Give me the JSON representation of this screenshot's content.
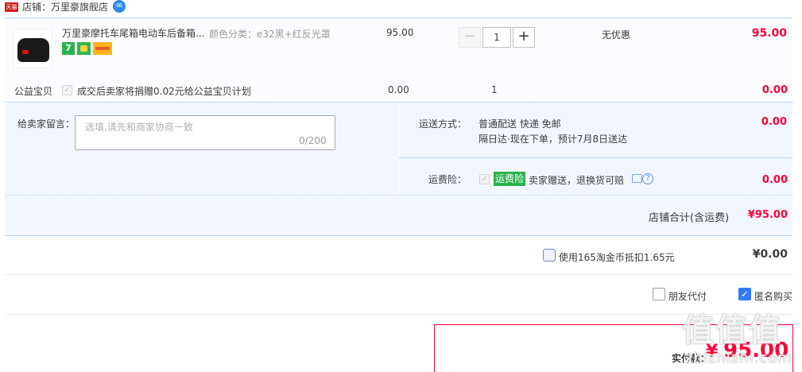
{
  "shop": {
    "name": "店铺：万里豪旗舰店",
    "logo_text": "天猫"
  },
  "item": {
    "title": "万里豪摩托车尾箱电动车后备箱...",
    "sku": "颜色分类：e32黑+红反光罩",
    "badges": [
      "7"
    ],
    "unit_price": "95.00",
    "quantity": "1",
    "minus_symbol": "−",
    "plus_symbol": "+",
    "discount": "无优惠",
    "total": "95.00"
  },
  "charity": {
    "label": "公益宝贝",
    "text": "成交后卖家将捐赠0.02元给公益宝贝计划",
    "price": "0.00",
    "qty": "1",
    "total": "0.00"
  },
  "message": {
    "label": "给卖家留言：",
    "placeholder": "选填,请先和商家协商一致",
    "counter": "0/200"
  },
  "shipping": {
    "label": "运送方式：",
    "method": "普通配送 快递 免邮",
    "eta": "隔日达·现在下单，预计7月8日送达",
    "fee": "0.00"
  },
  "insurance": {
    "label": "运费险：",
    "tag": "运费险",
    "text": "卖家赠送，退换货可赔",
    "help": "?",
    "fee": "0.00"
  },
  "shop_total": {
    "label": "店铺合计(含运费)",
    "value": "¥95.00"
  },
  "coins": {
    "text": "使用165淘金币抵扣1.65元",
    "value": "¥0.00"
  },
  "options": {
    "friend_pay": "朋友代付",
    "anonymous": "匿名购买",
    "anonymous_checked": true
  },
  "payment": {
    "label": "实付款：",
    "currency": "¥",
    "value": "95.00"
  },
  "watermark": {
    "main": "值值值",
    "sub": "zhizhizhi.com"
  },
  "colors": {
    "accent_red": "#ff0036",
    "light_blue_bg": "#f2f7ff",
    "checkbox_blue": "#2f7cf6",
    "tag_green": "#2bb24c"
  },
  "icons": {
    "shop": "tmall-logo-icon",
    "chat": "chat-bubble-icon",
    "check": "checkmark-icon",
    "help": "question-circle-icon"
  }
}
